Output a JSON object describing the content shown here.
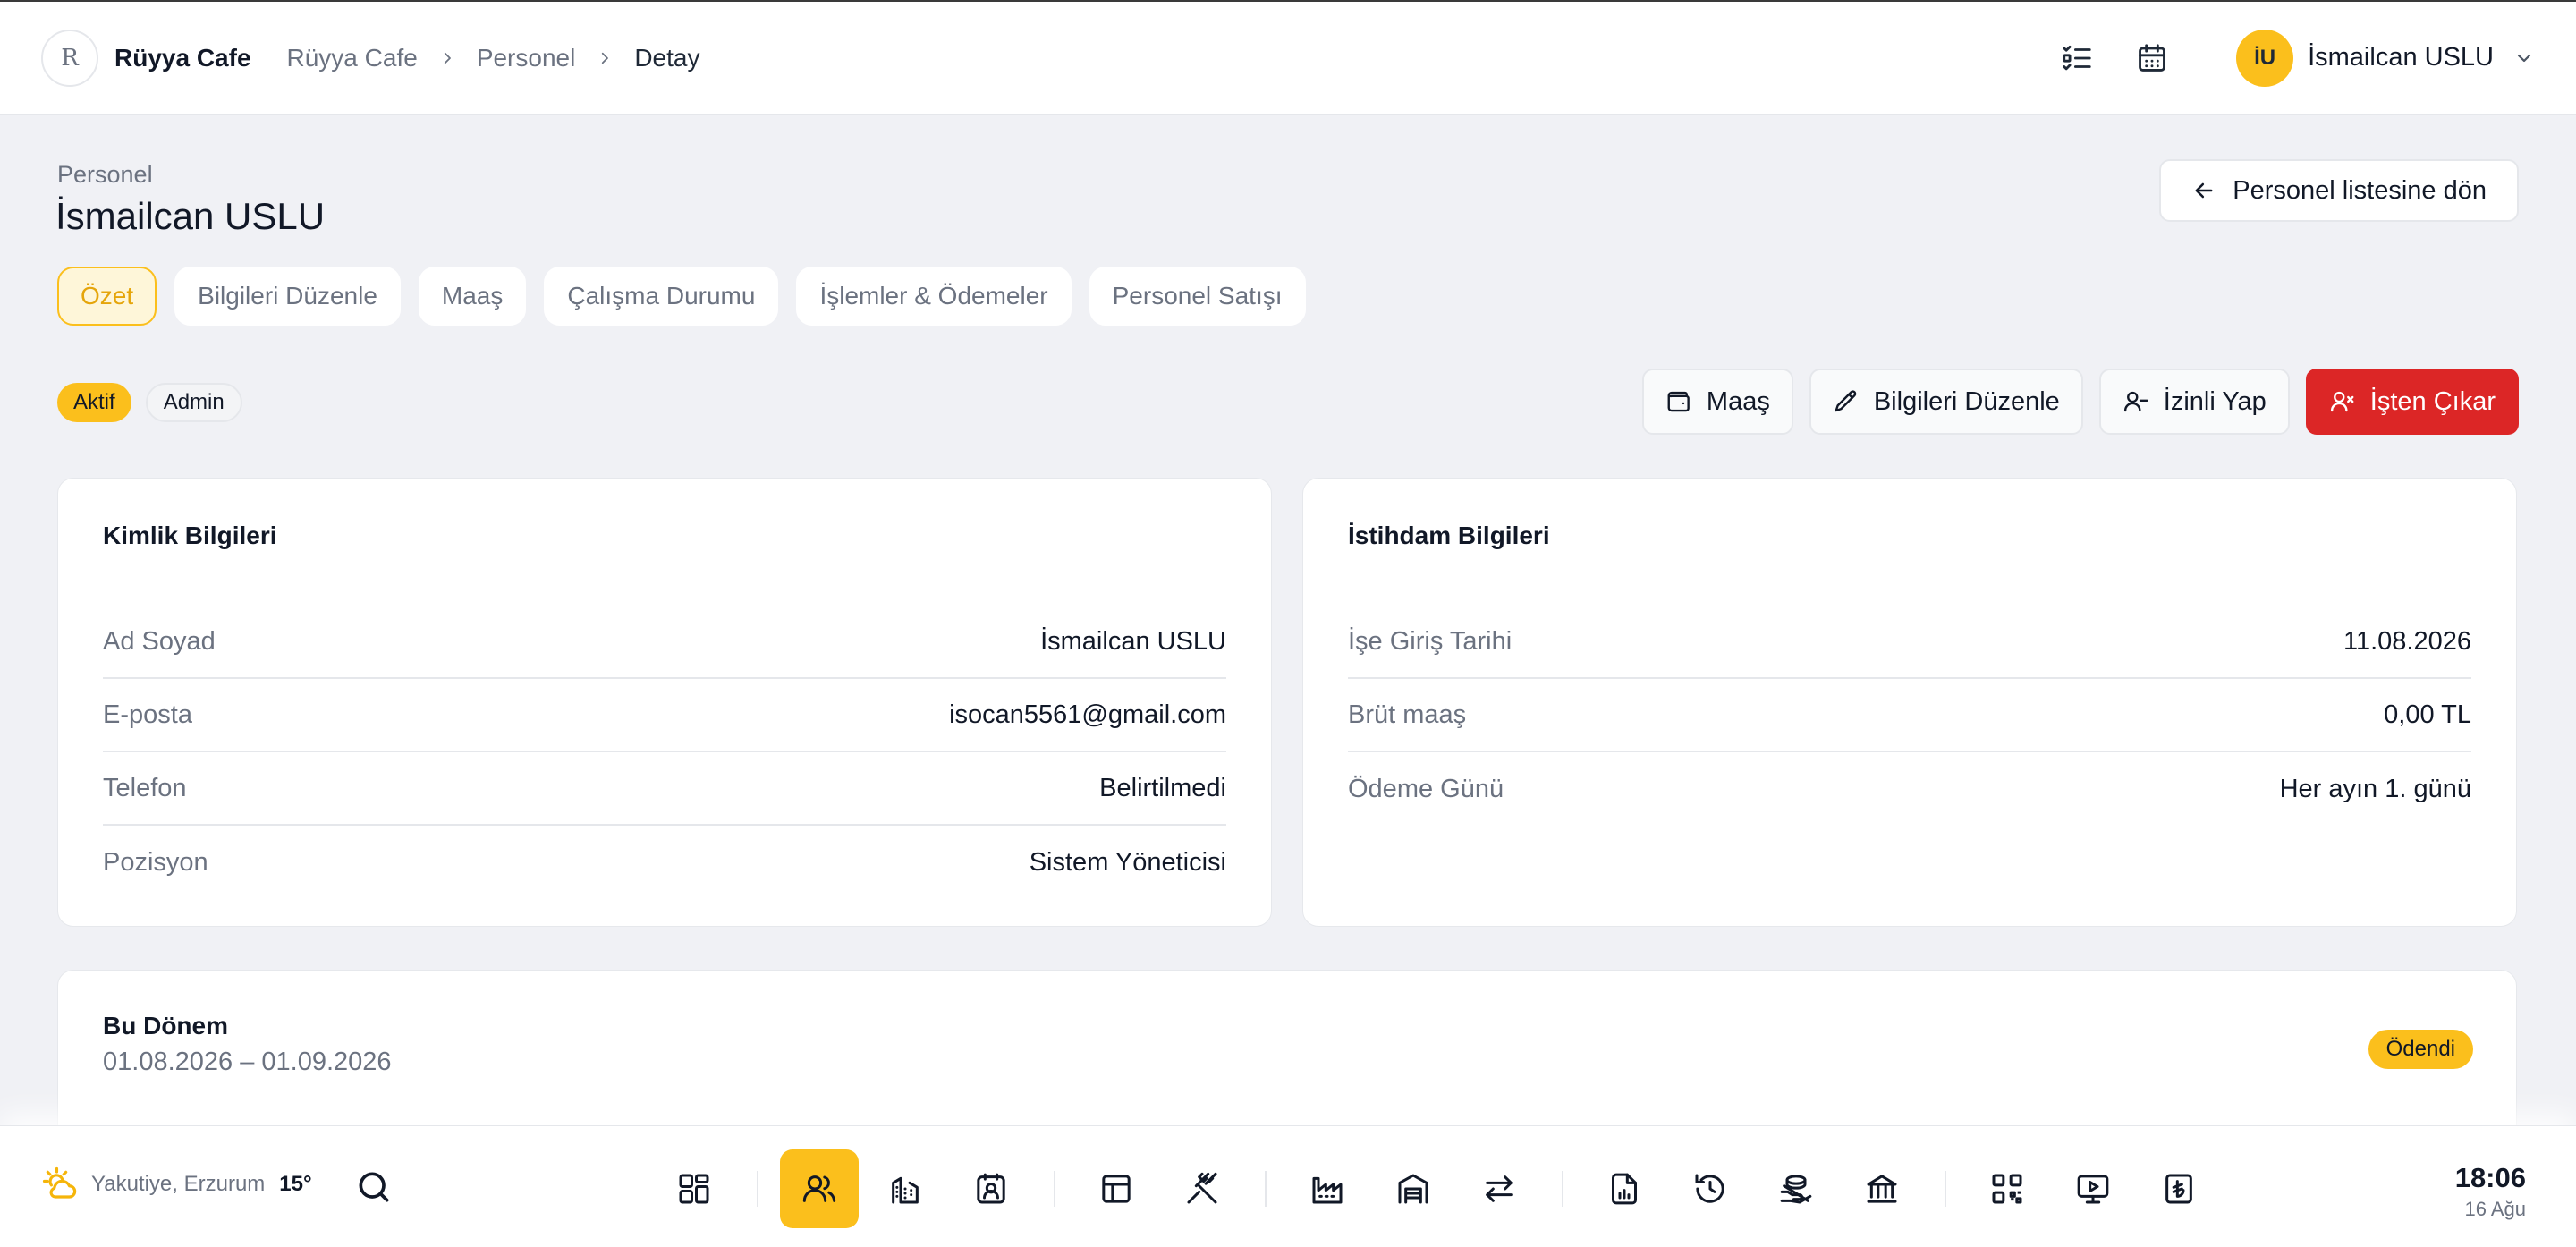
{
  "app": {
    "brand": "Rüyya Cafe",
    "logo_text": "R"
  },
  "breadcrumb": [
    "Rüyya Cafe",
    "Personel",
    "Detay"
  ],
  "user": {
    "initials": "İU",
    "name": "İsmailcan USLU"
  },
  "header": {
    "section": "Personel",
    "title": "İsmailcan USLU",
    "back_label": "Personel listesine dön"
  },
  "tabs": [
    {
      "label": "Özet",
      "active": true
    },
    {
      "label": "Bilgileri Düzenle"
    },
    {
      "label": "Maaş"
    },
    {
      "label": "Çalışma Durumu"
    },
    {
      "label": "İşlemler & Ödemeler"
    },
    {
      "label": "Personel Satışı"
    }
  ],
  "badges": {
    "status": "Aktif",
    "role": "Admin"
  },
  "actions": {
    "salary": "Maaş",
    "edit": "Bilgileri Düzenle",
    "leave": "İzinli Yap",
    "dismiss": "İşten Çıkar"
  },
  "identity": {
    "title": "Kimlik Bilgileri",
    "rows": [
      {
        "key": "Ad Soyad",
        "value": "İsmailcan USLU"
      },
      {
        "key": "E-posta",
        "value": "isocan5561@gmail.com"
      },
      {
        "key": "Telefon",
        "value": "Belirtilmedi"
      },
      {
        "key": "Pozisyon",
        "value": "Sistem Yöneticisi"
      }
    ]
  },
  "employment": {
    "title": "İstihdam Bilgileri",
    "rows": [
      {
        "key": "İşe Giriş Tarihi",
        "value": "11.08.2026"
      },
      {
        "key": "Brüt maaş",
        "value": "0,00 TL"
      },
      {
        "key": "Ödeme Günü",
        "value": "Her ayın 1. günü"
      }
    ]
  },
  "period": {
    "title": "Bu Dönem",
    "range": "01.08.2026 – 01.09.2026",
    "status": "Ödendi"
  },
  "dock": {
    "weather": {
      "location": "Yakutiye, Erzurum",
      "temp": "15°"
    },
    "time": "18:06",
    "date": "16 Ağu"
  },
  "colors": {
    "accent": "#fbbf1c",
    "danger": "#dc2626",
    "bg": "#f0f1f5"
  }
}
